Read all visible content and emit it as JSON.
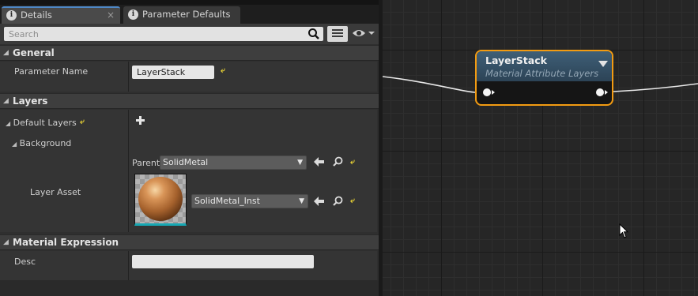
{
  "tabs": [
    {
      "label": "Details",
      "active": true,
      "closable": true
    },
    {
      "label": "Parameter Defaults",
      "active": false
    }
  ],
  "search": {
    "placeholder": "Search",
    "value": ""
  },
  "categories": {
    "general": {
      "title": "General",
      "parameter_name_label": "Parameter Name",
      "parameter_name_value": "LayerStack"
    },
    "layers": {
      "title": "Layers",
      "default_layers_label": "Default Layers",
      "background_label": "Background",
      "parent_label": "Parent",
      "parent_value": "SolidMetal",
      "layer_asset_label": "Layer Asset",
      "layer_asset_value": "SolidMetal_Inst"
    },
    "material_expression": {
      "title": "Material Expression",
      "desc_label": "Desc",
      "desc_value": ""
    }
  },
  "node": {
    "title": "LayerStack",
    "subtitle": "Material Attribute Layers",
    "border_color": "#f29b12",
    "header_color": "#3f5f77"
  },
  "icons": {
    "tab_icon": "info-icon",
    "search": "magnifier-icon",
    "view_options": "list-view-icon",
    "visibility": "eye-icon",
    "add": "plus-icon",
    "use_selected": "left-arrow-icon",
    "browse": "magnifier-icon",
    "reset": "reset-to-default-arrow-icon"
  },
  "colors": {
    "accent_tab": "#4f88c6",
    "reset_arrow": "#e8d234",
    "thumbnail_underline": "#16a8b4"
  }
}
